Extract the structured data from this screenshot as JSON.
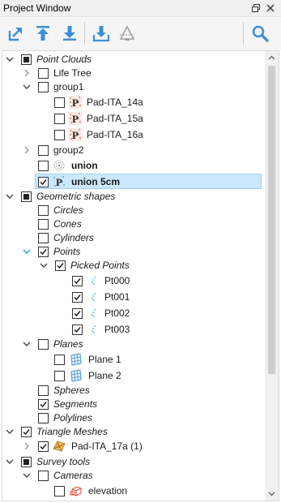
{
  "window": {
    "title": "Project Window"
  },
  "toolbar": {
    "buttons": [
      {
        "icon": "export-arrow-icon"
      },
      {
        "icon": "upload-arrow-icon"
      },
      {
        "icon": "download-arrow-icon"
      },
      {
        "icon": "import-to-tray-icon"
      },
      {
        "icon": "scan-station-icon"
      },
      {
        "icon": "search-icon"
      }
    ]
  },
  "tree": {
    "point_clouds": {
      "label": "Point Clouds",
      "state": "partial"
    },
    "life_tree": {
      "label": "Life Tree"
    },
    "group1": {
      "label": "group1"
    },
    "pad14": {
      "label": "Pad-ITA_14a"
    },
    "pad15": {
      "label": "Pad-ITA_15a"
    },
    "pad16": {
      "label": "Pad-ITA_16a"
    },
    "group2": {
      "label": "group2"
    },
    "union": {
      "label": "union"
    },
    "union5": {
      "label": "union 5cm",
      "selected": true
    },
    "geometric": {
      "label": "Geometric shapes",
      "state": "partial"
    },
    "circles": {
      "label": "Circles"
    },
    "cones": {
      "label": "Cones"
    },
    "cylinders": {
      "label": "Cylinders"
    },
    "points": {
      "label": "Points"
    },
    "picked": {
      "label": "Picked Points"
    },
    "pt000": {
      "label": "Pt000"
    },
    "pt001": {
      "label": "Pt001"
    },
    "pt002": {
      "label": "Pt002"
    },
    "pt003": {
      "label": "Pt003"
    },
    "planes": {
      "label": "Planes"
    },
    "plane1": {
      "label": "Plane 1"
    },
    "plane2": {
      "label": "Plane 2"
    },
    "spheres": {
      "label": "Spheres"
    },
    "segments": {
      "label": "Segments"
    },
    "polylines": {
      "label": "Polylines"
    },
    "meshes": {
      "label": "Triangle Meshes"
    },
    "pad17": {
      "label": "Pad-ITA_17a (1)"
    },
    "survey": {
      "label": "Survey tools",
      "state": "partial"
    },
    "cameras": {
      "label": "Cameras"
    },
    "elevation": {
      "label": "elevation"
    }
  },
  "colors": {
    "toolbar_icon": "#3d8fd6",
    "selection_bg": "#cce8ff",
    "selection_border": "#99d1ff",
    "expand_arrow_active": "#1a9fd9"
  }
}
